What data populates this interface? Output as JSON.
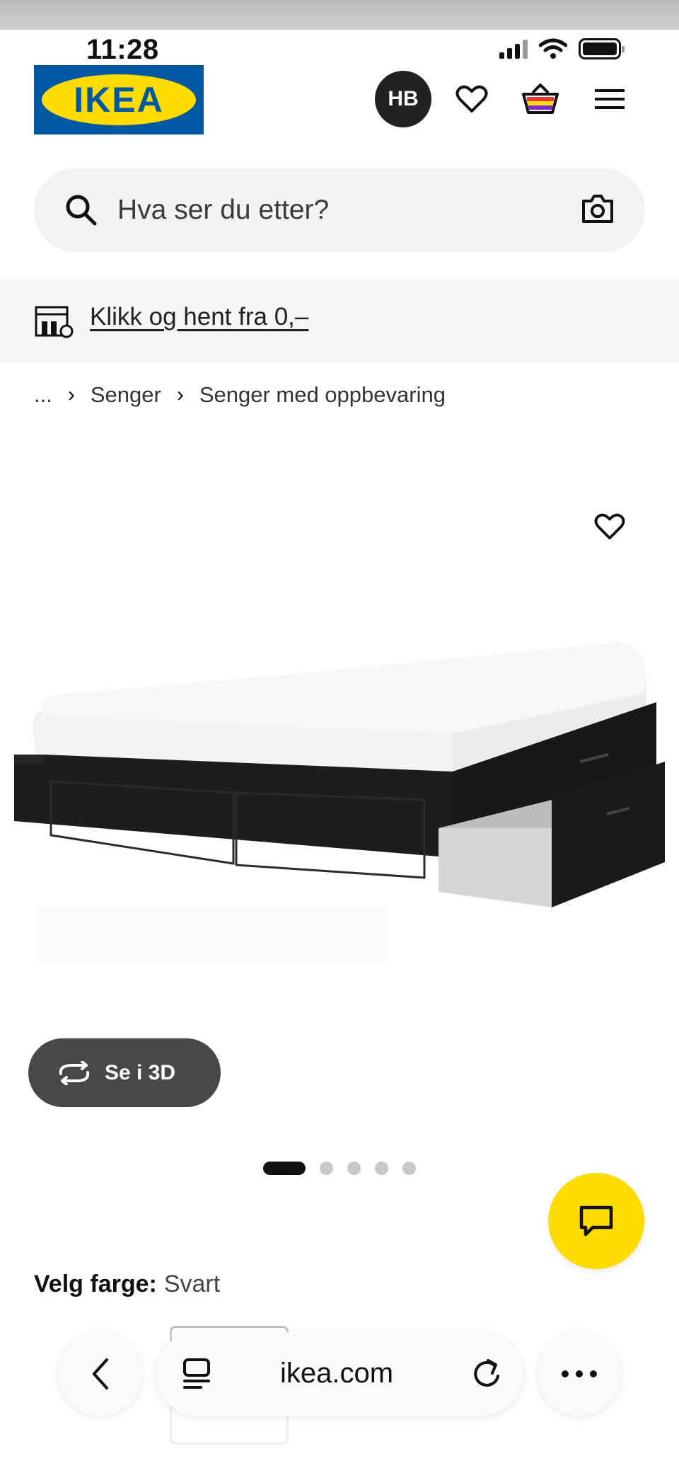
{
  "status_bar": {
    "time": "11:28"
  },
  "header": {
    "logo_text": "IKEA",
    "avatar_initials": "HB",
    "icons": [
      "heart-icon",
      "shopping-bag-icon",
      "menu-icon"
    ]
  },
  "search": {
    "placeholder": "Hva ser du etter?",
    "value": ""
  },
  "promo": {
    "link_text": "Klikk og hent fra 0,–"
  },
  "breadcrumb": {
    "ellipsis": "...",
    "items": [
      "Senger",
      "Senger med oppbevaring"
    ]
  },
  "gallery": {
    "view_3d_label": "Se i 3D",
    "image_count": 5,
    "active_index": 0
  },
  "product": {
    "color_label": "Velg farge:",
    "color_value": "Svart"
  },
  "browser": {
    "url": "ikea.com"
  },
  "colors": {
    "ikea_blue": "#0058a3",
    "ikea_yellow": "#ffdb00",
    "button_dark": "#484848"
  }
}
